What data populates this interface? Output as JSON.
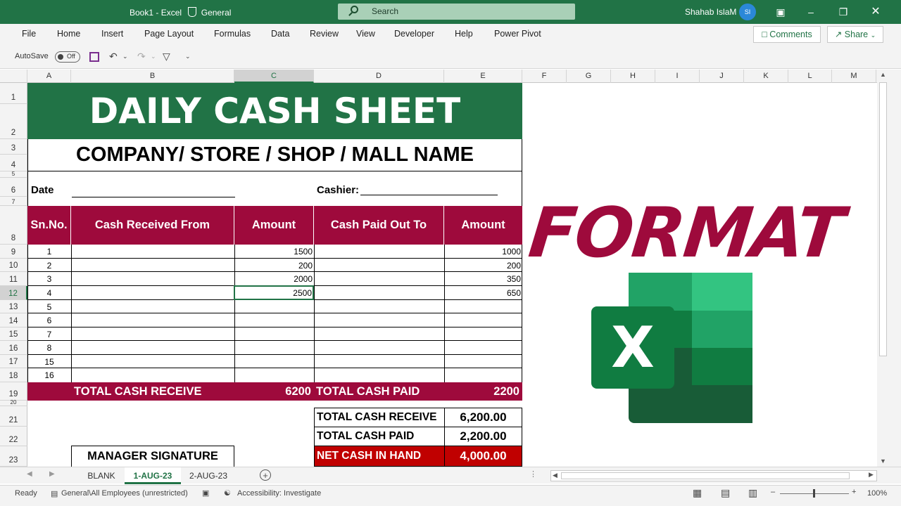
{
  "titlebar": {
    "doc_title": "Book1  -  Excel",
    "sensitivity": "General",
    "search_label": "Search",
    "user_name": "Shahab IslaM",
    "user_initials": "SI"
  },
  "menu": {
    "items": [
      "File",
      "Home",
      "Insert",
      "Page Layout",
      "Formulas",
      "Data",
      "Review",
      "View",
      "Developer",
      "Help",
      "Power Pivot"
    ],
    "comments": "Comments",
    "share": "Share"
  },
  "qat": {
    "autosave": "AutoSave",
    "toggle": "Off"
  },
  "columns": [
    "A",
    "B",
    "C",
    "D",
    "E",
    "F",
    "G",
    "H",
    "I",
    "J",
    "K",
    "L",
    "M"
  ],
  "row_numbers": [
    "1",
    "2",
    "3",
    "4",
    "5",
    "6",
    "7",
    "8",
    "9",
    "10",
    "11",
    "12",
    "13",
    "14",
    "15",
    "16",
    "17",
    "18",
    "19",
    "20",
    "21",
    "22",
    "23"
  ],
  "sheet": {
    "title": "DAILY CASH SHEET",
    "company": "COMPANY/ STORE / SHOP / MALL  NAME",
    "date_label": "Date",
    "cashier_label": "Cashier:",
    "headers": {
      "sn": "Sn.No.",
      "received_from": "Cash Received From",
      "amount_in": "Amount",
      "paid_to": "Cash Paid Out To",
      "amount_out": "Amount"
    },
    "rows": [
      {
        "sn": "1",
        "amount_in": "1500",
        "amount_out": "1000"
      },
      {
        "sn": "2",
        "amount_in": "200",
        "amount_out": "200"
      },
      {
        "sn": "3",
        "amount_in": "2000",
        "amount_out": "350"
      },
      {
        "sn": "4",
        "amount_in": "2500",
        "amount_out": "650"
      },
      {
        "sn": "5",
        "amount_in": "",
        "amount_out": ""
      },
      {
        "sn": "6",
        "amount_in": "",
        "amount_out": ""
      },
      {
        "sn": "7",
        "amount_in": "",
        "amount_out": ""
      },
      {
        "sn": "8",
        "amount_in": "",
        "amount_out": ""
      },
      {
        "sn": "15",
        "amount_in": "",
        "amount_out": ""
      },
      {
        "sn": "16",
        "amount_in": "",
        "amount_out": ""
      }
    ],
    "total_receive_label": "TOTAL CASH RECEIVE",
    "total_receive_value": "6200",
    "total_paid_label": "TOTAL CASH PAID",
    "total_paid_value": "2200",
    "summary": [
      {
        "label": "TOTAL CASH RECEIVE",
        "value": "6,200.00"
      },
      {
        "label": "TOTAL CASH PAID",
        "value": "2,200.00"
      },
      {
        "label": "NET CASH IN HAND",
        "value": "4,000.00"
      }
    ],
    "manager_signature": "MANAGER SIGNATURE"
  },
  "graphic": {
    "word": "FORMAT",
    "logo_letter": "X"
  },
  "tabs": [
    "BLANK",
    "1-AUG-23",
    "2-AUG-23"
  ],
  "status": {
    "ready": "Ready",
    "label": "General\\All Employees (unrestricted)",
    "accessibility": "Accessibility: Investigate",
    "zoom": "100%"
  },
  "colors": {
    "excel_green": "#217346",
    "crimson": "#9e0a3c",
    "net_red": "#c00000"
  }
}
